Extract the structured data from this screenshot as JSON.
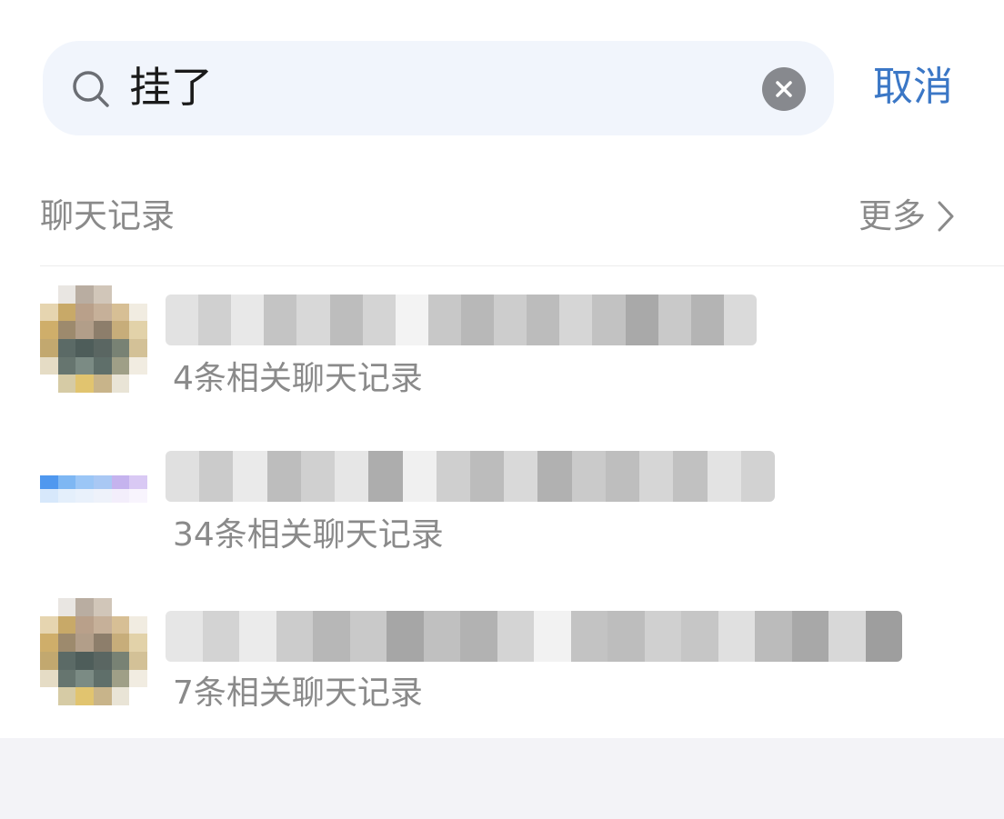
{
  "search": {
    "query": "挂了",
    "cancel_label": "取消"
  },
  "section": {
    "title": "聊天记录",
    "more_label": "更多"
  },
  "results": [
    {
      "count_text": "4条相关聊天记录"
    },
    {
      "count_text": "34条相关聊天记录"
    },
    {
      "count_text": "7条相关聊天记录"
    }
  ],
  "colors": {
    "accent": "#3b77c6",
    "search_bg": "#f1f5fc",
    "secondary_text": "#8a8a8a"
  },
  "icons": {
    "search": "search-icon",
    "clear": "clear-icon",
    "chevron": "chevron-right-icon"
  }
}
